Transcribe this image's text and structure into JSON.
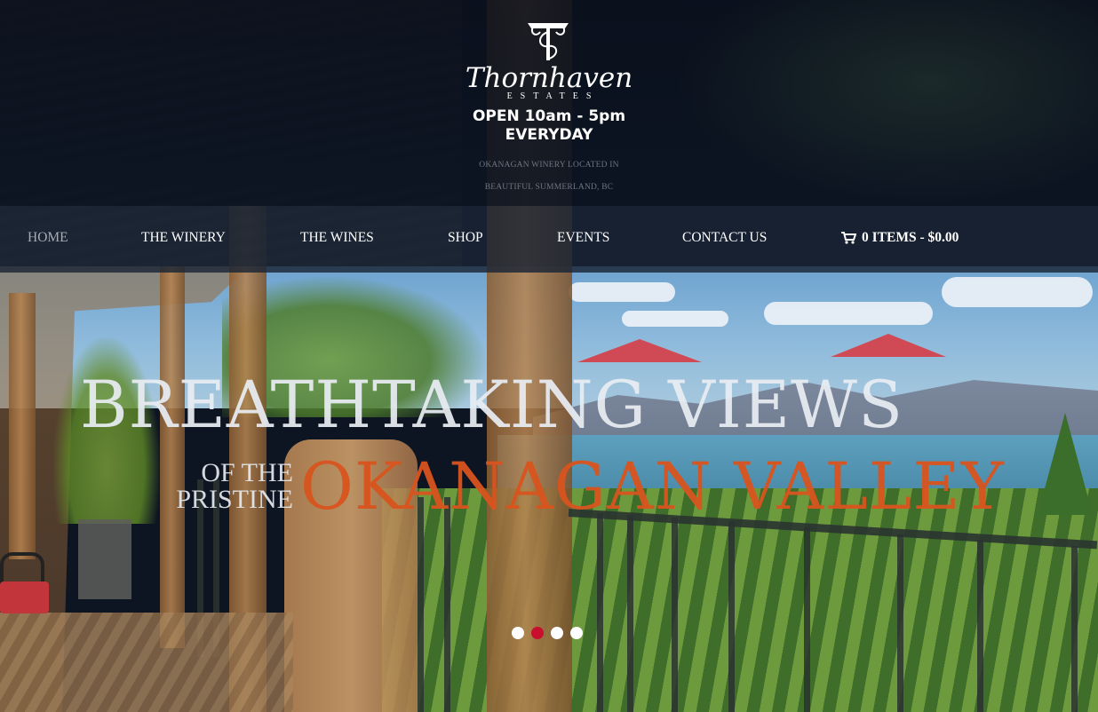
{
  "brand": {
    "name": "Thornhaven",
    "subtitle": "ESTATES",
    "hours_line1": "OPEN 10am - 5pm",
    "hours_line2": "EVERYDAY",
    "tagline_line1": "OKANAGAN WINERY LOCATED IN",
    "tagline_line2": "BEAUTIFUL SUMMERLAND, BC"
  },
  "nav": {
    "items": [
      {
        "label": "HOME",
        "active": true
      },
      {
        "label": "THE WINERY",
        "active": false
      },
      {
        "label": "THE WINES",
        "active": false
      },
      {
        "label": "SHOP",
        "active": false
      },
      {
        "label": "EVENTS",
        "active": false
      },
      {
        "label": "CONTACT US",
        "active": false
      }
    ],
    "cart_label": "0 ITEMS - $0.00",
    "cart_icon": "shopping-cart-icon"
  },
  "hero": {
    "line1": "BREATHTAKING VIEWS",
    "sub_line1": "OF THE",
    "sub_line2": "PRISTINE",
    "line2": "OKANAGAN VALLEY",
    "accent_color": "#d9541e"
  },
  "slider": {
    "total_slides": 4,
    "active_slide": 2,
    "active_color": "#c8102e"
  }
}
